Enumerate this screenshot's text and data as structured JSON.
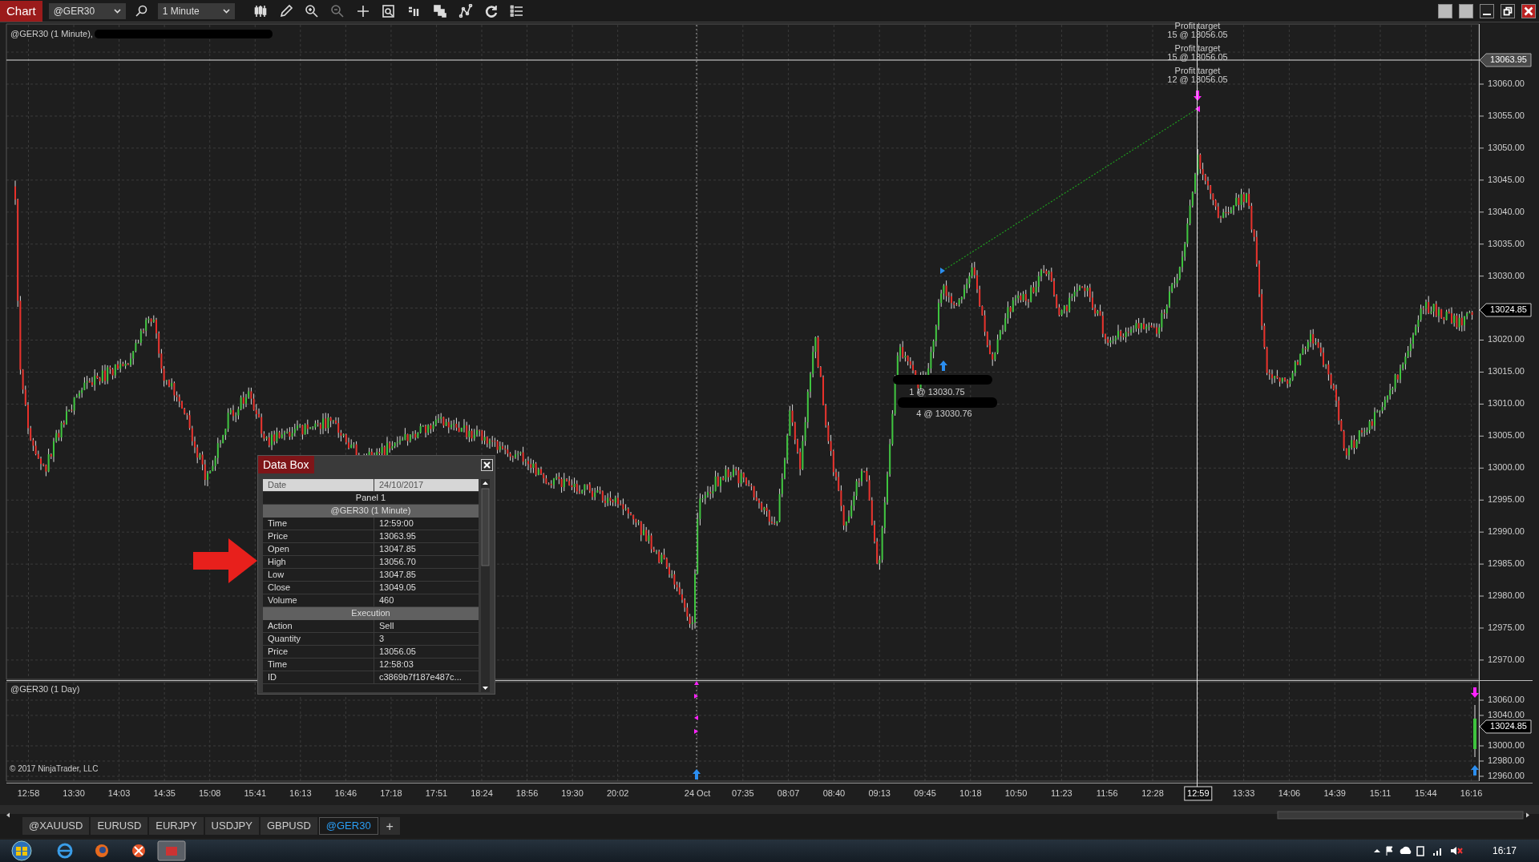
{
  "toolbar": {
    "title": "Chart",
    "instrument": "@GER30",
    "interval": "1 Minute"
  },
  "chart": {
    "title": "@GER30 (1 Minute),",
    "price_labels": [
      "13060.00",
      "13055.00",
      "13050.00",
      "13045.00",
      "13040.00",
      "13035.00",
      "13030.00",
      "13020.00",
      "13015.00",
      "13010.00",
      "13005.00",
      "13000.00",
      "12995.00",
      "12990.00",
      "12985.00",
      "12980.00",
      "12975.00",
      "12970.00"
    ],
    "crosshair_price": "13063.95",
    "last_price": "13024.85",
    "profit_targets": [
      {
        "label": "Profit target",
        "order": "15 @ 13056.05"
      },
      {
        "label": "Profit target",
        "order": "15 @ 13056.05"
      },
      {
        "label": "Profit target",
        "order": "12 @ 13056.05"
      }
    ],
    "fills": [
      "1 @ 13030.75",
      "4 @ 13030.76"
    ]
  },
  "lower_panel": {
    "title": "@GER30 (1 Day)",
    "price_labels": [
      "13060.00",
      "13040.00",
      "13000.00",
      "12980.00",
      "12960.00"
    ],
    "last_price": "13024.85",
    "copyright": "© 2017 NinjaTrader, LLC"
  },
  "time_axis": {
    "labels": [
      {
        "text": "12:58",
        "selected": false
      },
      {
        "text": "13:30",
        "selected": false
      },
      {
        "text": "14:03",
        "selected": false
      },
      {
        "text": "14:35",
        "selected": false
      },
      {
        "text": "15:08",
        "selected": false
      },
      {
        "text": "15:41",
        "selected": false
      },
      {
        "text": "16:13",
        "selected": false
      },
      {
        "text": "16:46",
        "selected": false
      },
      {
        "text": "17:18",
        "selected": false
      },
      {
        "text": "17:51",
        "selected": false
      },
      {
        "text": "18:24",
        "selected": false
      },
      {
        "text": "18:56",
        "selected": false
      },
      {
        "text": "19:30",
        "selected": false
      },
      {
        "text": "20:02",
        "selected": false
      },
      {
        "text": "24 Oct",
        "selected": false
      },
      {
        "text": "07:35",
        "selected": false
      },
      {
        "text": "08:07",
        "selected": false
      },
      {
        "text": "08:40",
        "selected": false
      },
      {
        "text": "09:13",
        "selected": false
      },
      {
        "text": "09:45",
        "selected": false
      },
      {
        "text": "10:18",
        "selected": false
      },
      {
        "text": "10:50",
        "selected": false
      },
      {
        "text": "11:23",
        "selected": false
      },
      {
        "text": "11:56",
        "selected": false
      },
      {
        "text": "12:28",
        "selected": false
      },
      {
        "text": "12:59",
        "selected": true
      },
      {
        "text": "13:33",
        "selected": false
      },
      {
        "text": "14:06",
        "selected": false
      },
      {
        "text": "14:39",
        "selected": false
      },
      {
        "text": "15:11",
        "selected": false
      },
      {
        "text": "15:44",
        "selected": false
      },
      {
        "text": "16:16",
        "selected": false
      }
    ]
  },
  "data_box": {
    "title": "Data Box",
    "rows": [
      {
        "kind": "date",
        "label": "Date",
        "value": "24/10/2017"
      },
      {
        "kind": "panel",
        "label": "Panel 1"
      },
      {
        "kind": "section",
        "label": "@GER30 (1 Minute)"
      },
      {
        "kind": "field",
        "label": "Time",
        "value": "12:59:00"
      },
      {
        "kind": "field",
        "label": "Price",
        "value": "13063.95"
      },
      {
        "kind": "field",
        "label": "Open",
        "value": "13047.85"
      },
      {
        "kind": "field",
        "label": "High",
        "value": "13056.70"
      },
      {
        "kind": "field",
        "label": "Low",
        "value": "13047.85"
      },
      {
        "kind": "field",
        "label": "Close",
        "value": "13049.05"
      },
      {
        "kind": "field",
        "label": "Volume",
        "value": "460"
      },
      {
        "kind": "section",
        "label": "Execution"
      },
      {
        "kind": "field",
        "label": "Action",
        "value": "Sell"
      },
      {
        "kind": "field",
        "label": "Quantity",
        "value": "3"
      },
      {
        "kind": "field",
        "label": "Price",
        "value": "13056.05"
      },
      {
        "kind": "field",
        "label": "Time",
        "value": "12:58:03"
      },
      {
        "kind": "field",
        "label": "ID",
        "value": "c3869b7f187e487c..."
      }
    ]
  },
  "tabs": [
    {
      "label": "@XAUUSD",
      "selected": false
    },
    {
      "label": "EURUSD",
      "selected": false
    },
    {
      "label": "EURJPY",
      "selected": false
    },
    {
      "label": "USDJPY",
      "selected": false
    },
    {
      "label": "GBPUSD",
      "selected": false
    },
    {
      "label": "@GER30",
      "selected": true
    }
  ],
  "add_tab": "+",
  "taskbar": {
    "clock": "16:17"
  }
}
